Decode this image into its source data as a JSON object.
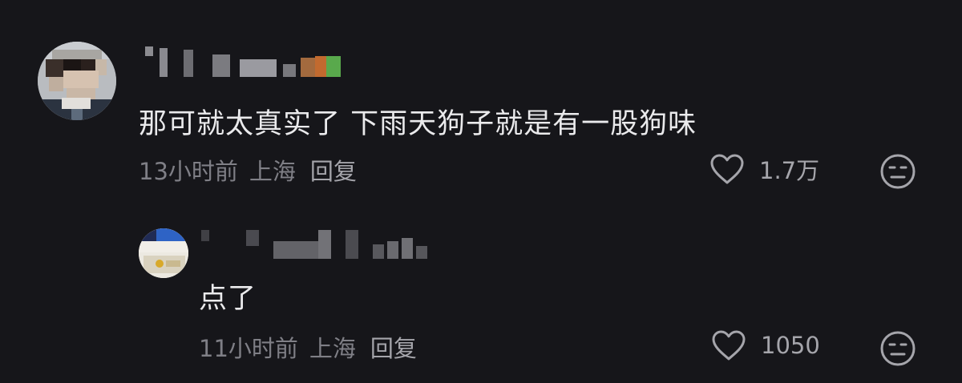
{
  "comments": [
    {
      "text": "那可就太真实了 下雨天狗子就是有一股狗味",
      "time": "13小时前",
      "location": "上海",
      "reply_label": "回复",
      "likes": "1.7万"
    },
    {
      "text": "点了",
      "time": "11小时前",
      "location": "上海",
      "reply_label": "回复",
      "likes": "1050"
    }
  ],
  "icons": {
    "like": "heart-outline-icon",
    "emoji": "neutral-face-icon"
  },
  "colors": {
    "background": "#16161a",
    "text": "#eaeaec",
    "meta": "#7f7f86"
  }
}
